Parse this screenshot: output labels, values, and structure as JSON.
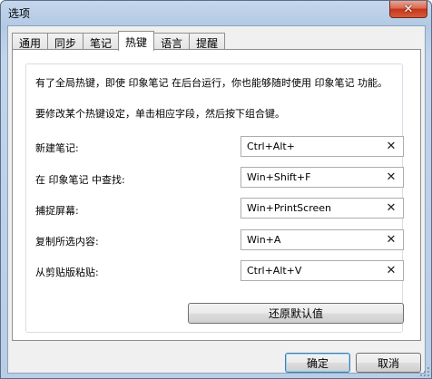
{
  "window": {
    "title": "选项",
    "close_glyph": "✕"
  },
  "tabs": [
    {
      "label": "通用",
      "active": false
    },
    {
      "label": "同步",
      "active": false
    },
    {
      "label": "笔记",
      "active": false
    },
    {
      "label": "热键",
      "active": true
    },
    {
      "label": "语言",
      "active": false
    },
    {
      "label": "提醒",
      "active": false
    }
  ],
  "hotkeys": {
    "description_1": "有了全局热键，即使 印象笔记 在后台运行，你也能够随时使用 印象笔记 功能。",
    "description_2": "要修改某个热键设定，单击相应字段，然后按下组合键。",
    "rows": [
      {
        "label": "新建笔记:",
        "value": "Ctrl+Alt+"
      },
      {
        "label": "在 印象笔记 中查找:",
        "value": "Win+Shift+F"
      },
      {
        "label": "捕捉屏幕:",
        "value": "Win+PrintScreen"
      },
      {
        "label": "复制所选内容:",
        "value": "Win+A"
      },
      {
        "label": "从剪贴版粘贴:",
        "value": "Ctrl+Alt+V"
      }
    ],
    "clear_glyph": "✕",
    "restore_defaults_label": "还原默认值"
  },
  "dialog_buttons": {
    "ok_label": "确定",
    "cancel_label": "取消"
  },
  "colors": {
    "window_frame": "#b9cde6",
    "close_button": "#c4351a",
    "client_bg": "#f0f0f0",
    "panel_bg": "#ffffff"
  }
}
